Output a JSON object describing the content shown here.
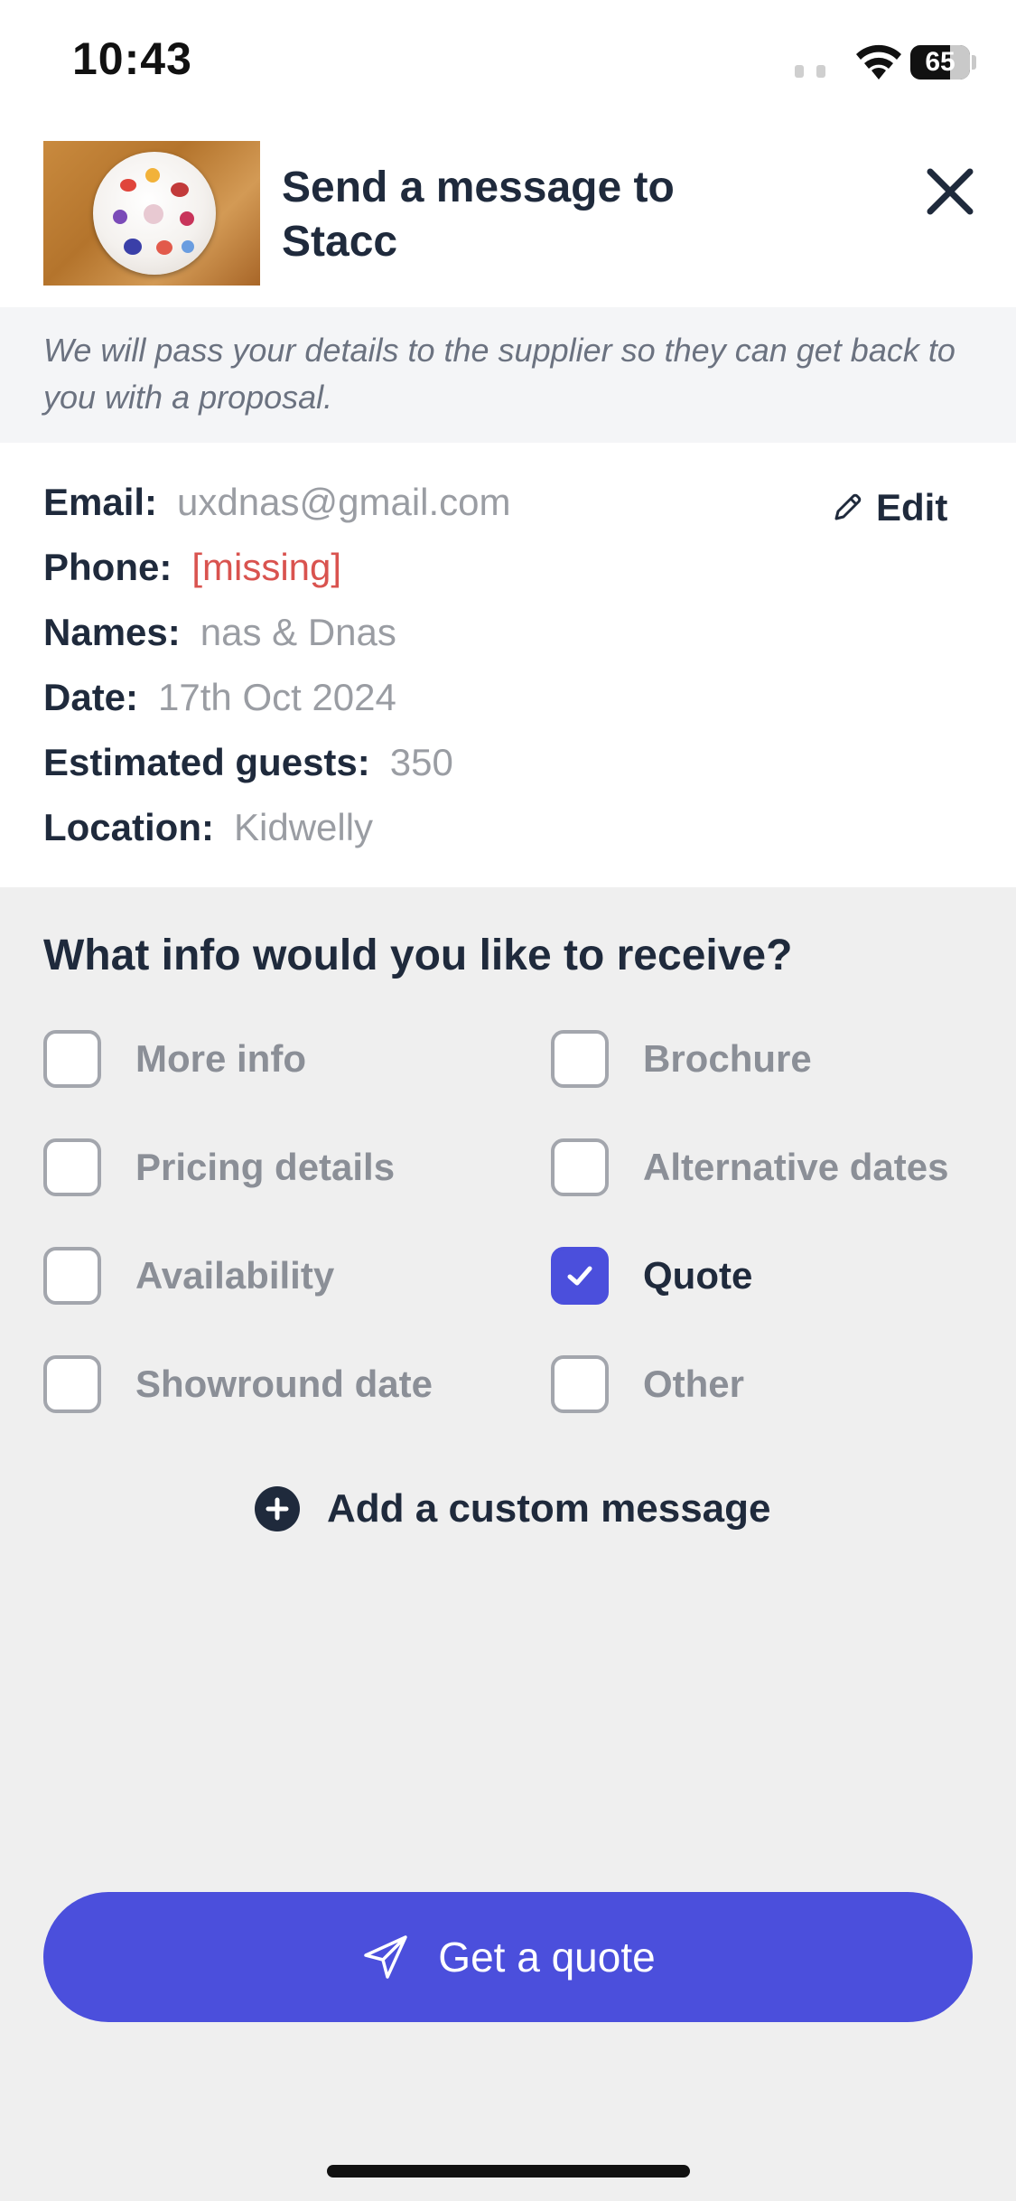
{
  "status_bar": {
    "time": "10:43",
    "battery": "65"
  },
  "header": {
    "title": "Send a message to Stacc"
  },
  "notice": "We will pass your details to the supplier so they can get back to you with a proposal.",
  "details": {
    "edit_label": "Edit",
    "fields": [
      {
        "label": "Email:",
        "value": "uxdnas@gmail.com"
      },
      {
        "label": "Phone:",
        "value": "[missing]"
      },
      {
        "label": "Names:",
        "value": "nas & Dnas"
      },
      {
        "label": "Date:",
        "value": "17th Oct 2024"
      },
      {
        "label": "Estimated guests:",
        "value": "350"
      },
      {
        "label": "Location:",
        "value": "Kidwelly"
      }
    ]
  },
  "info_section": {
    "title": "What info would you like to receive?",
    "options": [
      {
        "label": "More info",
        "checked": false
      },
      {
        "label": "Brochure",
        "checked": false
      },
      {
        "label": "Pricing details",
        "checked": false
      },
      {
        "label": "Alternative dates",
        "checked": false
      },
      {
        "label": "Availability",
        "checked": false
      },
      {
        "label": "Quote",
        "checked": true
      },
      {
        "label": "Showround date",
        "checked": false
      },
      {
        "label": "Other",
        "checked": false
      }
    ],
    "custom_message_label": "Add a custom message"
  },
  "cta": {
    "label": "Get a quote"
  },
  "colors": {
    "accent": "#4b4fdc",
    "missing": "#d9534f",
    "text": "#1f2a3c"
  }
}
